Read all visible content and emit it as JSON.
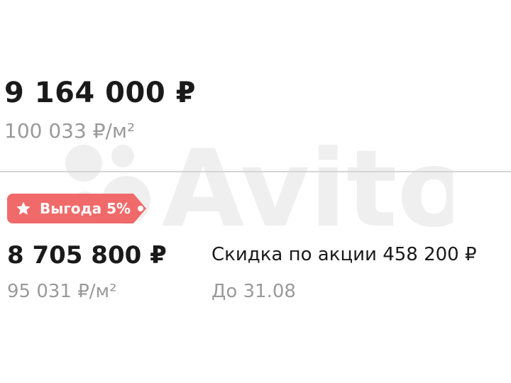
{
  "listing": {
    "price": "9 164 000 ₽",
    "price_per_m2": "100 033 ₽/м²"
  },
  "promo": {
    "badge_label": "Выгода 5%",
    "badge_color": "#f06a6a",
    "badge_icon": "star-icon",
    "discounted_price": "8 705 800 ₽",
    "discounted_price_per_m2": "95 031 ₽/м²",
    "discount_text": "Скидка по акции 458 200 ₽",
    "valid_until": "До 31.08"
  }
}
